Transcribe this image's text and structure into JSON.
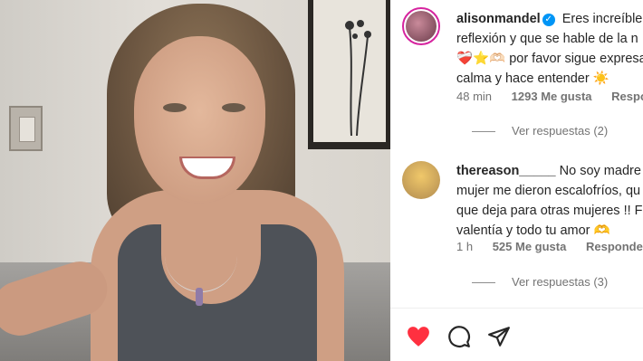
{
  "comments": [
    {
      "username": "alisonmandel",
      "verified": true,
      "text_line1": " Eres increíble",
      "text_line2": "reflexión y que se hable de la n",
      "text_line3": "❤️‍🩹⭐️🫶🏻 por favor sigue expresa",
      "text_line4": "calma y hace entender ☀️",
      "time": "48 min",
      "likes": "1293 Me gusta",
      "reply": "Responder",
      "view_replies": "Ver respuestas (2)"
    },
    {
      "username": "thereason_____",
      "verified": false,
      "text_line1": "  No soy madre",
      "text_line2": "mujer me dieron escalofríos, qu",
      "text_line3": "que deja para otras mujeres !! F",
      "text_line4": "valentía y todo tu amor 🫶",
      "time": "1 h",
      "likes": "525 Me gusta",
      "reply": "Responder",
      "view_replies": "Ver respuestas (3)"
    }
  ],
  "icons": {
    "like": "heart-icon",
    "comment": "comment-bubble-icon",
    "share": "paper-plane-icon"
  },
  "colors": {
    "like_red": "#ff3040",
    "verified_blue": "#0095f6",
    "text": "#262626",
    "secondary": "#737373"
  }
}
